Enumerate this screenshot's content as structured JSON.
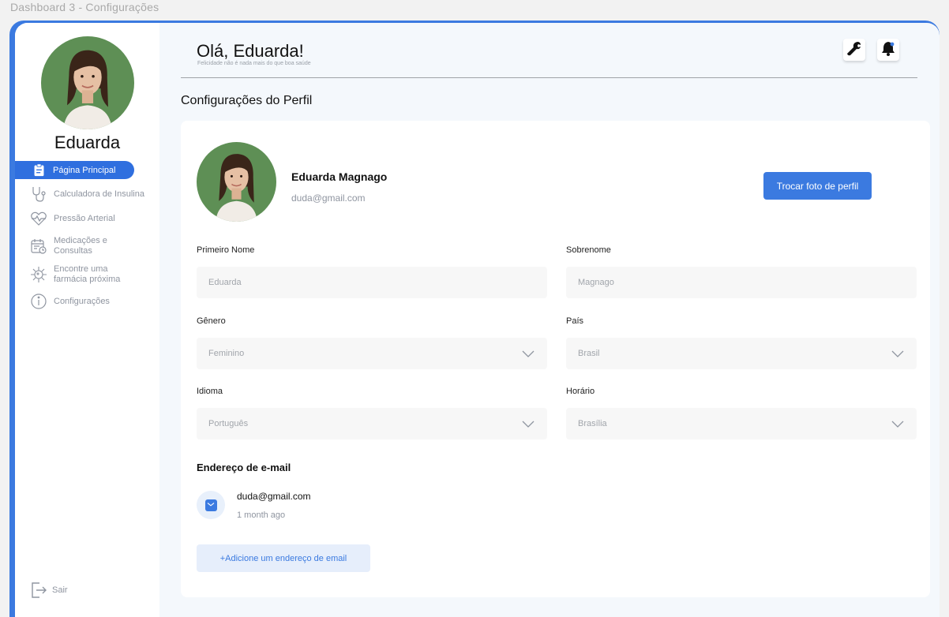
{
  "window_title": "Dashboard 3 - Configurações",
  "sidebar": {
    "user_name": "Eduarda",
    "active_item": {
      "label": "Página Principal",
      "icon": "clipboard-icon"
    },
    "items": [
      {
        "label": "Calculadora de Insulina",
        "icon": "stethoscope-icon"
      },
      {
        "label": "Pressão Arterial",
        "icon": "heart-pulse-icon"
      },
      {
        "label": "Medicações e Consultas",
        "icon": "calendar-clock-icon"
      },
      {
        "label": "Encontre uma farmácia próxima",
        "icon": "virus-icon"
      },
      {
        "label": "Configurações",
        "icon": "info-icon"
      }
    ],
    "logout_label": "Sair"
  },
  "header": {
    "greeting": "Olá, Eduarda!",
    "tagline": "Felicidade não é nada mais do que boa saúde",
    "tools": [
      {
        "icon": "wrench-icon"
      },
      {
        "icon": "bell-icon"
      }
    ]
  },
  "section_title": "Configurações do Perfil",
  "profile": {
    "full_name": "Eduarda Magnago",
    "email": "duda@gmail.com",
    "change_photo_label": "Trocar foto de perfil"
  },
  "form": {
    "first_name": {
      "label": "Primeiro Nome",
      "placeholder": "Eduarda"
    },
    "last_name": {
      "label": "Sobrenome",
      "placeholder": "Magnago"
    },
    "gender": {
      "label": "Gênero",
      "value": "Feminino"
    },
    "country": {
      "label": "País",
      "value": "Brasil"
    },
    "language": {
      "label": "Idioma",
      "value": "Português"
    },
    "timezone": {
      "label": "Horário",
      "value": "Brasília"
    }
  },
  "emails": {
    "title": "Endereço de e-mail",
    "items": [
      {
        "address": "duda@gmail.com",
        "time": "1 month ago"
      }
    ],
    "add_label": "+Adicione um endereço de email"
  },
  "colors": {
    "accent": "#3b7ae0",
    "frame": "#3b7ae0",
    "avatar_bg": "#5e8f55"
  }
}
